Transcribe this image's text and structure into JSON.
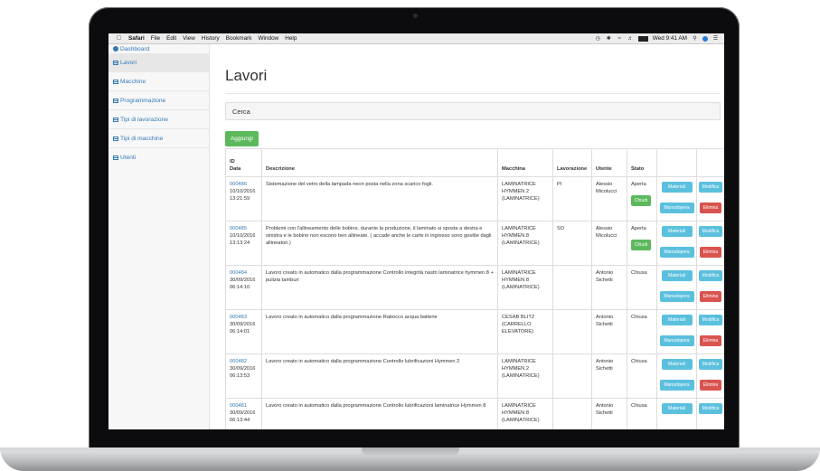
{
  "menubar": {
    "items": [
      "Safari",
      "File",
      "Edit",
      "View",
      "History",
      "Bookmark",
      "Window",
      "Help"
    ],
    "clock": "Wed 9:41 AM"
  },
  "sidebar": {
    "dashboard": "Dashboard",
    "items": [
      {
        "label": "Lavori"
      },
      {
        "label": "Macchine"
      },
      {
        "label": "Programmazione"
      },
      {
        "label": "Tipi di lavorazione"
      },
      {
        "label": "Tipi di macchine"
      },
      {
        "label": "Utenti"
      }
    ]
  },
  "main": {
    "title": "Lavori",
    "search_label": "Cerca",
    "add_button": "Aggiungi"
  },
  "table": {
    "headers": {
      "id": "ID",
      "data": "Data",
      "descrizione": "Descrizione",
      "macchina": "Macchina",
      "lavorazione": "Lavorazione",
      "utente": "Utente",
      "stato": "Stato"
    },
    "buttons": {
      "materiali": "Materiali",
      "manodopera": "Manodopera",
      "modifica": "Modifica",
      "elimina": "Elimina",
      "chiudi": "Chiudi"
    },
    "rows": [
      {
        "id": "000486",
        "date": "10/10/2016",
        "time": "13:21:59",
        "desc": "Sistemazione del vetro della lampada neon posta nella zona scarico fogli.",
        "machine": "LAMINATRICE HYMMEN 2 (LAMINATRICE)",
        "lav": "PI",
        "user": "Alessio Micolucci",
        "status": "Aperta"
      },
      {
        "id": "000485",
        "date": "10/10/2016",
        "time": "13:13:24",
        "desc": "Problemi con l'allineamento delle bobine, durante la produzione, il laminato si sposta a destra e sinistra e le bobine non escono ben allineate. ( accade anche le carte in ingresso sono gestite dagli allineatori.)",
        "machine": "LAMINATRICE HYMMEN 8 (LAMINATRICE)",
        "lav": "SO",
        "user": "Alessio Micolucci",
        "status": "Aperta"
      },
      {
        "id": "000484",
        "date": "30/09/2016",
        "time": "06:14:10",
        "desc": "Lavoro creato in automatico dalla programmazione Controllo integrità nastri laminatrice hymmen 8 + pulizia tamburi",
        "machine": "LAMINATRICE HYMMEN 8 (LAMINATRICE)",
        "lav": "",
        "user": "Antonio Sichetti",
        "status": "Chiusa"
      },
      {
        "id": "000483",
        "date": "30/09/2016",
        "time": "06:14:01",
        "desc": "Lavoro creato in automatico dalla programmazione Rabocco acqua batterie",
        "machine": "CESAB BLITZ (CARRELLO ELEVATORE)",
        "lav": "",
        "user": "Antonio Sichetti",
        "status": "Chiusa"
      },
      {
        "id": "000482",
        "date": "30/09/2016",
        "time": "06:13:53",
        "desc": "Lavoro creato in automatico dalla programmazione Controllo lubrificazioni Hymmen 2",
        "machine": "LAMINATRICE HYMMEN 2 (LAMINATRICE)",
        "lav": "",
        "user": "Antonio Sichetti",
        "status": "Chiusa"
      },
      {
        "id": "000481",
        "date": "30/09/2016",
        "time": "06:13:44",
        "desc": "Lavoro creato in automatico dalla programmazione Controllo lubrificazioni laminatrice Hymmen 8",
        "machine": "LAMINATRICE HYMMEN 8 (LAMINATRICE)",
        "lav": "",
        "user": "Antonio Sichetti",
        "status": "Chiusa"
      }
    ]
  }
}
